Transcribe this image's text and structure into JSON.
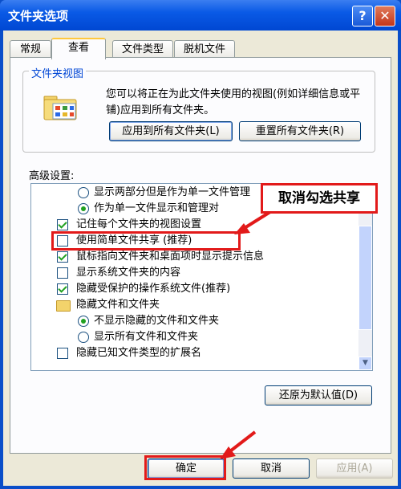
{
  "window": {
    "title": "文件夹选项",
    "help": "?",
    "close": "✕"
  },
  "tabs": [
    {
      "label": "常规"
    },
    {
      "label": "查看"
    },
    {
      "label": "文件类型"
    },
    {
      "label": "脱机文件"
    }
  ],
  "folder_views": {
    "legend": "文件夹视图",
    "description": "您可以将正在为此文件夹使用的视图(例如详细信息或平铺)应用到所有文件夹。",
    "apply_all_label": "应用到所有文件夹(L)",
    "reset_all_label": "重置所有文件夹(R)"
  },
  "advanced": {
    "label": "高级设置:",
    "items": [
      {
        "type": "radio",
        "checked": false,
        "label": "显示两部分但是作为单一文件管理"
      },
      {
        "type": "radio",
        "checked": true,
        "label": "作为单一文件显示和管理对"
      },
      {
        "type": "checkbox",
        "checked": true,
        "label": "记住每个文件夹的视图设置"
      },
      {
        "type": "checkbox",
        "checked": false,
        "label": "使用简单文件共享 (推荐)"
      },
      {
        "type": "checkbox",
        "checked": true,
        "label": "鼠标指向文件夹和桌面项时显示提示信息"
      },
      {
        "type": "checkbox",
        "checked": false,
        "label": "显示系统文件夹的内容"
      },
      {
        "type": "checkbox",
        "checked": true,
        "label": "隐藏受保护的操作系统文件(推荐)"
      },
      {
        "type": "folder",
        "label": "隐藏文件和文件夹"
      },
      {
        "type": "radio",
        "checked": true,
        "label": "不显示隐藏的文件和文件夹"
      },
      {
        "type": "radio",
        "checked": false,
        "label": "显示所有文件和文件夹"
      },
      {
        "type": "checkbox",
        "checked": false,
        "label": "隐藏已知文件类型的扩展名"
      }
    ],
    "restore_defaults_label": "还原为默认值(D)"
  },
  "callout": {
    "text": "取消勾选共享"
  },
  "footer": {
    "ok_label": "确定",
    "cancel_label": "取消",
    "apply_label": "应用(A)"
  },
  "colors": {
    "title_blue": "#0a5ae6",
    "dialog_bg": "#ece9d8",
    "annotation_red": "#e21a1a",
    "check_green": "#21a121"
  }
}
